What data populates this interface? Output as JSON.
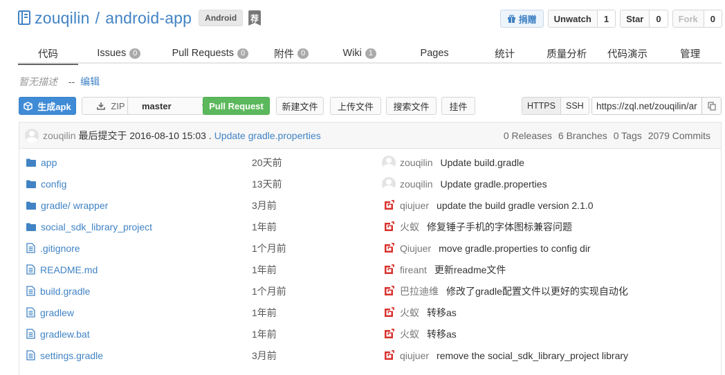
{
  "repo": {
    "owner": "zouqilin",
    "separator": "/",
    "name": "android-app",
    "language": "Android",
    "recommend_badge": "荐"
  },
  "actions": {
    "donate": "捐赠",
    "watch_label": "Unwatch",
    "watch_count": "1",
    "star_label": "Star",
    "star_count": "0",
    "fork_label": "Fork",
    "fork_count": "0"
  },
  "tabs": [
    {
      "label": "代码"
    },
    {
      "label": "Issues",
      "count": "0"
    },
    {
      "label": "Pull Requests",
      "count": "0"
    },
    {
      "label": "附件",
      "count": "0"
    },
    {
      "label": "Wiki",
      "count": "1"
    },
    {
      "label": "Pages"
    },
    {
      "label": "统计"
    },
    {
      "label": "质量分析"
    },
    {
      "label": "代码演示"
    },
    {
      "label": "管理"
    }
  ],
  "description": {
    "text": "暂无描述",
    "dash": "--",
    "edit_link": "编辑"
  },
  "toolbar": {
    "build_apk": "生成apk",
    "zip": "ZIP",
    "branch": "master",
    "pull_request": "Pull Request",
    "new_file": "新建文件",
    "upload_file": "上传文件",
    "search_file": "搜索文件",
    "widget": "挂件",
    "https": "HTTPS",
    "ssh": "SSH",
    "clone_url": "https://zql.net/zouqilin/ar"
  },
  "last_commit": {
    "author": "zouqilin",
    "text": "最后提交于 2016-08-10 15:03 .",
    "message": "Update gradle.properties"
  },
  "stats": {
    "releases": "0 Releases",
    "branches": "6 Branches",
    "tags": "0 Tags",
    "commits": "2079 Commits"
  },
  "files": [
    {
      "type": "folder",
      "name": "app",
      "age": "20天前",
      "avatar": "default",
      "author": "zouqilin",
      "message": "Update build.gradle"
    },
    {
      "type": "folder",
      "name": "config",
      "age": "13天前",
      "avatar": "default",
      "author": "zouqilin",
      "message": "Update gradle.properties"
    },
    {
      "type": "folder",
      "name": "gradle/ wrapper",
      "age": "3月前",
      "avatar": "logo",
      "author": "qiujuer",
      "message": "update the build gradle version 2.1.0"
    },
    {
      "type": "folder",
      "name": "social_sdk_library_project",
      "age": "1年前",
      "avatar": "logo",
      "author": "火蚁",
      "message": "修复锤子手机的字体图标兼容问题"
    },
    {
      "type": "file",
      "name": ".gitignore",
      "age": "1个月前",
      "avatar": "logo",
      "author": "Qiujuer",
      "message": "move gradle.properties to config dir"
    },
    {
      "type": "file",
      "name": "README.md",
      "age": "1年前",
      "avatar": "logo",
      "author": "fireant",
      "message": "更新readme文件"
    },
    {
      "type": "file",
      "name": "build.gradle",
      "age": "1个月前",
      "avatar": "logo",
      "author": "巴拉迪维",
      "message": "修改了gradle配置文件以更好的实现自动化"
    },
    {
      "type": "file",
      "name": "gradlew",
      "age": "1年前",
      "avatar": "logo",
      "author": "火蚁",
      "message": "转移as"
    },
    {
      "type": "file",
      "name": "gradlew.bat",
      "age": "1年前",
      "avatar": "logo",
      "author": "火蚁",
      "message": "转移as"
    },
    {
      "type": "file",
      "name": "settings.gradle",
      "age": "3月前",
      "avatar": "logo",
      "author": "qiujuer",
      "message": "remove the social_sdk_library_project library"
    }
  ],
  "colors": {
    "link": "#4183c4",
    "primary": "#3f8bd6",
    "success": "#5cb85c",
    "logo_red": "#d9322d"
  }
}
